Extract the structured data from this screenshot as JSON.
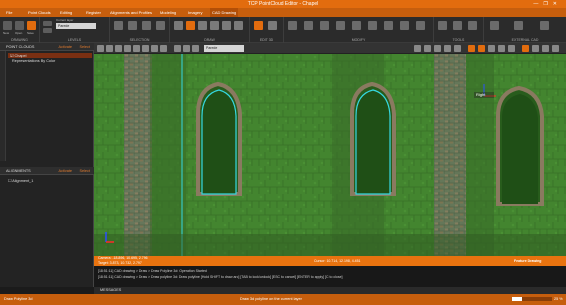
{
  "title": "TCP PointCloud Editor - Chapel",
  "window_controls": [
    "—",
    "❐",
    "✕"
  ],
  "menu": [
    "File",
    "Point Clouds",
    "Editing",
    "Register",
    "Alignments and Profiles",
    "Modeling",
    "Imagery",
    "CAD Drawing"
  ],
  "ribbon": {
    "groups": [
      "DRAWING",
      "LEVELS",
      "SELECTION",
      "DRAW",
      "EDIT 3D",
      "MODIFY",
      "TOOLS",
      "EXTERNAL CAD"
    ],
    "current_layer_label": "Current layer",
    "current_layer_value": "Parede",
    "buttons_drawing": [
      "New",
      "Open",
      "Save"
    ],
    "buttons_levels": [
      "New",
      "Delete"
    ],
    "buttons_selection": [
      "Rectangle",
      "Polygon",
      "Lasso",
      "All"
    ],
    "buttons_draw": [
      "Line",
      "Polyline",
      "Arc",
      "Circle",
      "Rectangle",
      "Text"
    ],
    "buttons_edit3d": [
      "Height",
      "Elevation"
    ],
    "buttons_modify": [
      "Move",
      "Rotate",
      "Scale",
      "Mirror",
      "Copy",
      "Offset",
      "Trim",
      "Extend",
      "Delete"
    ],
    "buttons_tools": [
      "Snap",
      "Measure",
      "Info"
    ],
    "buttons_external": [
      "Connect",
      "Synchronize",
      "Export"
    ]
  },
  "toolbar": {
    "dropdown_value": "Parede"
  },
  "left_panel": {
    "point_clouds_title": "POINT CLOUDS",
    "activate_label": "Activate",
    "select_label": "Select",
    "items": [
      "Chapel",
      "Representations By Color"
    ],
    "alignments_title": "ALIGNMENTS",
    "alignments_items": [
      "Alignment_1"
    ]
  },
  "viewport": {
    "label_right": "Right"
  },
  "status": {
    "camera": "Camera: -18.896, 10.695, 2.796",
    "target": "Target: 3.873, 10.732, 2.797",
    "cursor": "Cursor: 10.714, 12.198, 4.451",
    "mode": "Feature Drawing"
  },
  "messages": [
    "[18:51:11] CAD drawing > Draw > Draw Polyline 3d: Operation Started",
    "[18:51:11] CAD drawing > Draw > Draw polyline 3d: Draw polyline [Hold SHIFT to draw arc] [TAB to lock/unlock] [ESC to cancel] [ENTER to apply] [C to close]"
  ],
  "messages_title": "MESSAGES",
  "bottom": {
    "left": "Draw Polyline 3d",
    "center": "Draw 3d polyline on the current layer",
    "right": "25 %"
  }
}
